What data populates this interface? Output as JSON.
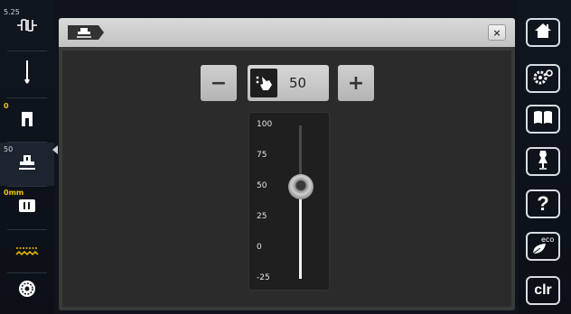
{
  "left_sidebar": {
    "stitch_width_value": "5.25",
    "needle_position_value": "0",
    "presser_foot_pressure_value": "50",
    "seam_allowance_value": "0mm"
  },
  "dialog": {
    "close_label": "×",
    "minus_label": "−",
    "plus_label": "+",
    "value": "50",
    "scale_labels": [
      "100",
      "75",
      "50",
      "25",
      "0",
      "-25"
    ],
    "slider": {
      "min": -25,
      "max": 100,
      "value": 50
    }
  },
  "right_sidebar": {
    "help_label": "?",
    "eco_label": "eco",
    "clr_label": "clr"
  },
  "icons": [
    "presser-foot-icon",
    "home-icon",
    "settings-icon",
    "book-icon",
    "dress-form-icon",
    "help-icon",
    "eco-leaf-icon",
    "thread-spool-icon"
  ]
}
